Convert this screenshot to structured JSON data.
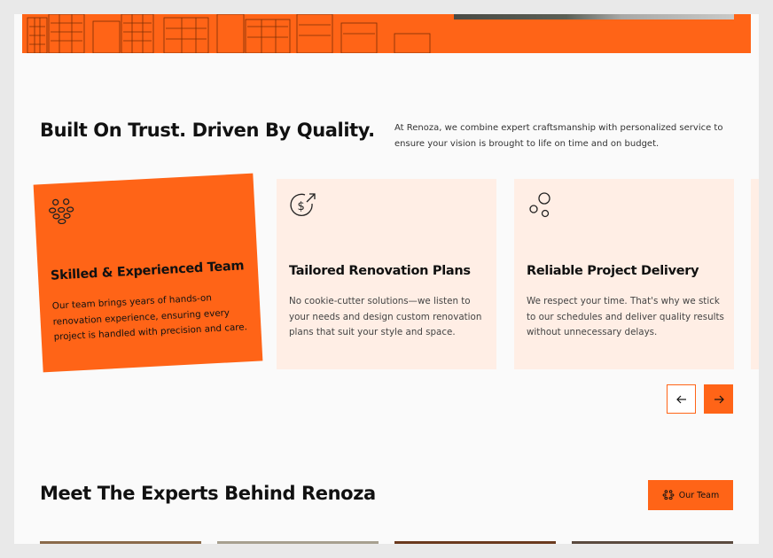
{
  "section": {
    "headline": "Built On Trust. Driven By Quality.",
    "intro": "At Renoza, we combine expert craftsmanship with personalized service to ensure your vision is brought to life on time and on budget."
  },
  "cards": [
    {
      "icon": "team-icon",
      "title": "Skilled & Experienced Team",
      "desc": "Our team brings years of hands-on renovation experience, ensuring every project is handled with precision and care."
    },
    {
      "icon": "dollar-growth-icon",
      "title": "Tailored Renovation Plans",
      "desc": "No cookie-cutter solutions—we listen to your needs and design custom renovation plans that suit your style and space."
    },
    {
      "icon": "bubbles-icon",
      "title": "Reliable Project Delivery",
      "desc": "We respect your time. That's why we stick to our schedules and deliver quality results without unnecessary delays."
    }
  ],
  "experts": {
    "heading": "Meet The Experts Behind Renoza",
    "button_label": "Our Team"
  },
  "colors": {
    "accent": "#ff6417",
    "card_bg": "#ffeee5",
    "page_bg": "#fafafa"
  }
}
